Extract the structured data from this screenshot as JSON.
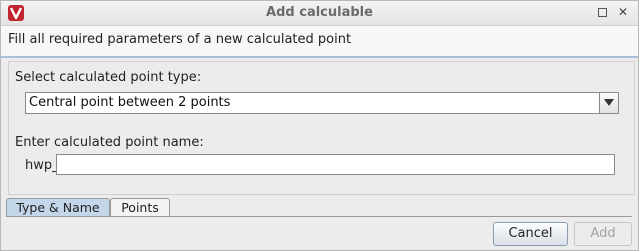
{
  "window": {
    "title": "Add calculable",
    "icons": {
      "app": "app-logo-icon",
      "maximize": "maximize-icon",
      "close": "close-icon"
    },
    "close_glyph": "✕"
  },
  "header": {
    "description": "Fill all required parameters of a new calculated point"
  },
  "form": {
    "type_label": "Select calculated point type:",
    "type_selected": "Central point between 2 points",
    "name_label": "Enter calculated point name:",
    "name_prefix": "hwp_",
    "name_value": ""
  },
  "tabs": [
    {
      "label": "Type & Name",
      "selected": true
    },
    {
      "label": "Points",
      "selected": false
    }
  ],
  "buttons": {
    "cancel": "Cancel",
    "add": "Add",
    "add_enabled": false
  },
  "colors": {
    "accent": "#c4d6ea",
    "app_icon_red": "#c0262d"
  }
}
